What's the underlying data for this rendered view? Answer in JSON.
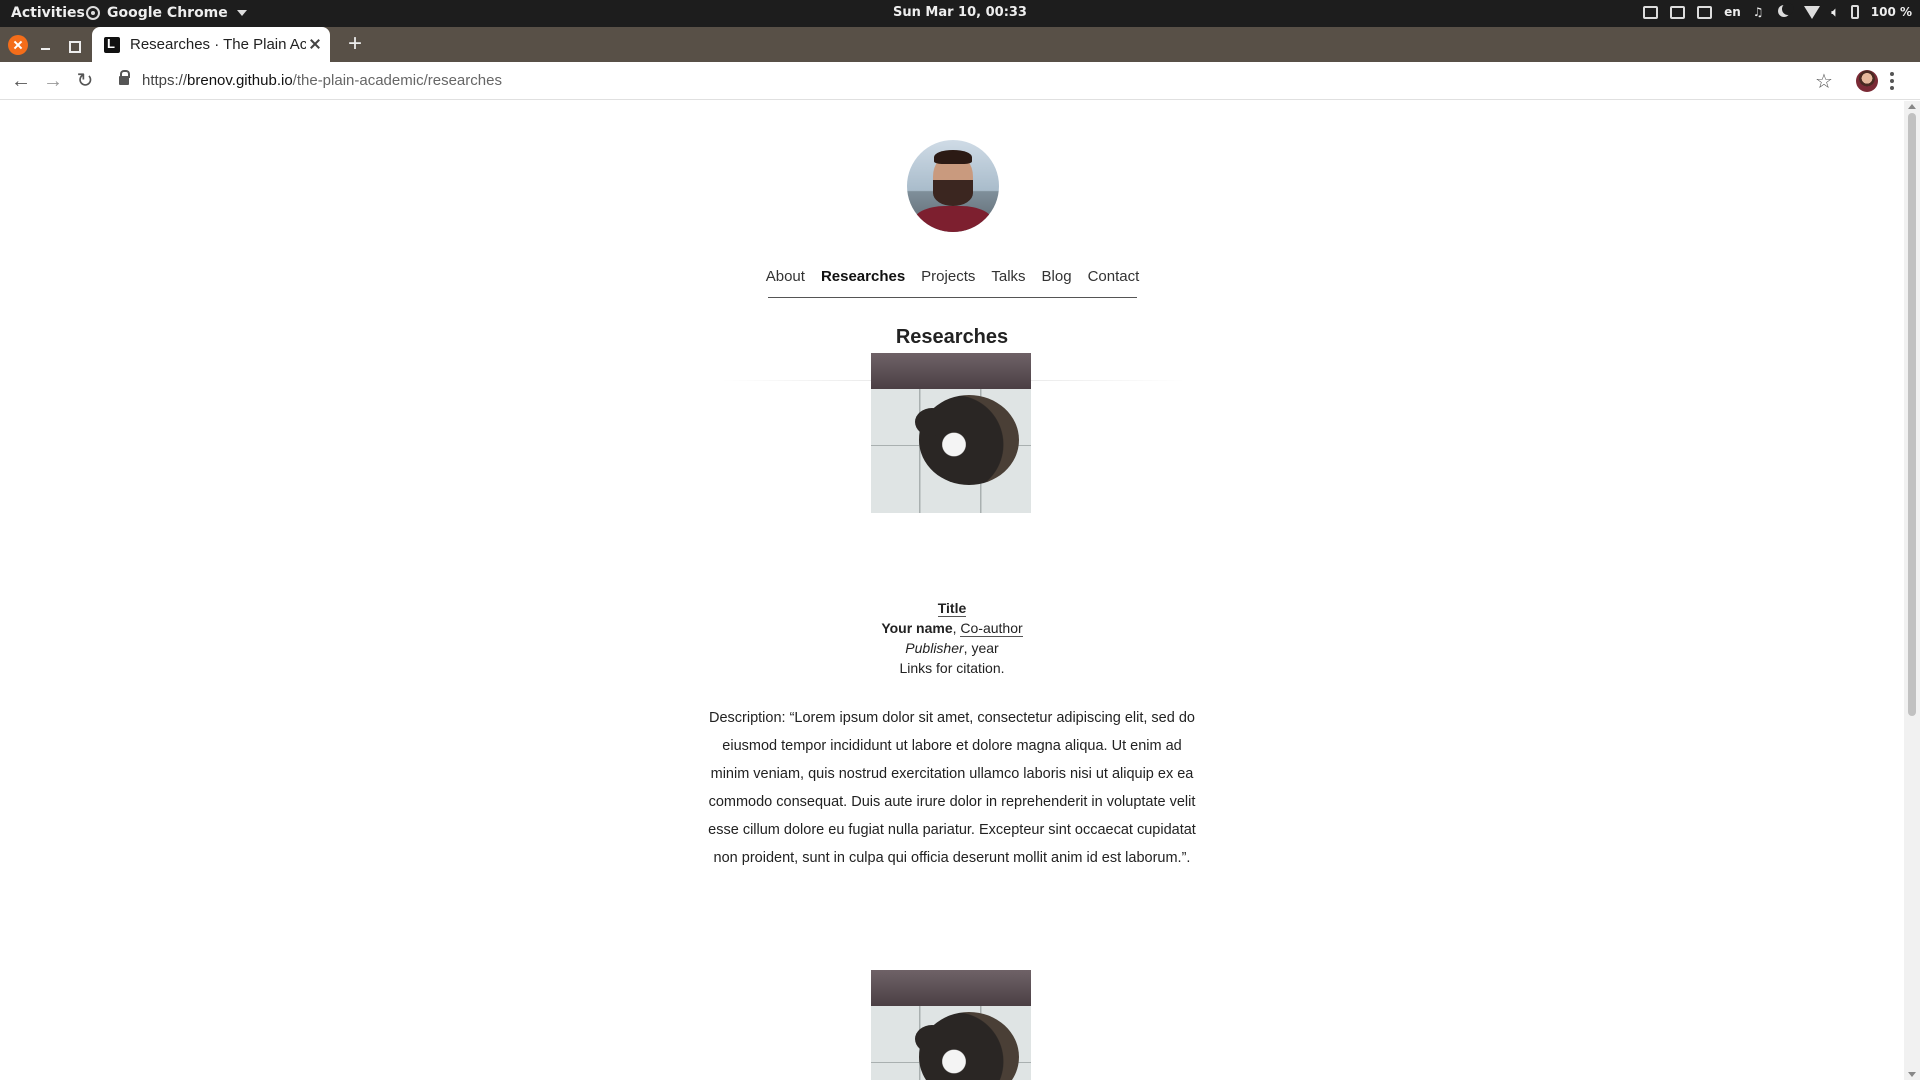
{
  "system": {
    "activities": "Activities",
    "app_name": "Google Chrome",
    "clock": "Sun Mar 10, 00:33",
    "lang": "en",
    "battery": "100 %"
  },
  "browser": {
    "tab_title": "Researches · The Plain Academic",
    "url_scheme": "https://",
    "url_host": "brenov.github.io",
    "url_path": "/the-plain-academic/researches"
  },
  "nav": {
    "items": [
      "About",
      "Researches",
      "Projects",
      "Talks",
      "Blog",
      "Contact"
    ],
    "active": "Researches"
  },
  "page": {
    "title": "Researches"
  },
  "research": [
    {
      "title": "Title",
      "author_self": "Your name",
      "author_sep": ", ",
      "coauthor": "Co-author",
      "publisher": "Publisher",
      "year": ", year",
      "links": "Links for citation.",
      "description": "Description: “Lorem ipsum dolor sit amet, consectetur adipiscing elit, sed do eiusmod tempor incididunt ut labore et dolore magna aliqua. Ut enim ad minim veniam, quis nostrud exercitation ullamco laboris nisi ut aliquip ex ea commodo consequat. Duis aute irure dolor in reprehenderit in voluptate velit esse cillum dolore eu fugiat nulla pariatur. Excepteur sint occaecat cupidatat non proident, sunt in culpa qui officia deserunt mollit anim id est laborum.”."
    }
  ],
  "icons": {
    "back": "back-arrow-icon",
    "forward": "forward-arrow-icon",
    "reload": "reload-icon",
    "star": "bookmark-star-icon",
    "menu": "kebab-menu-icon"
  }
}
